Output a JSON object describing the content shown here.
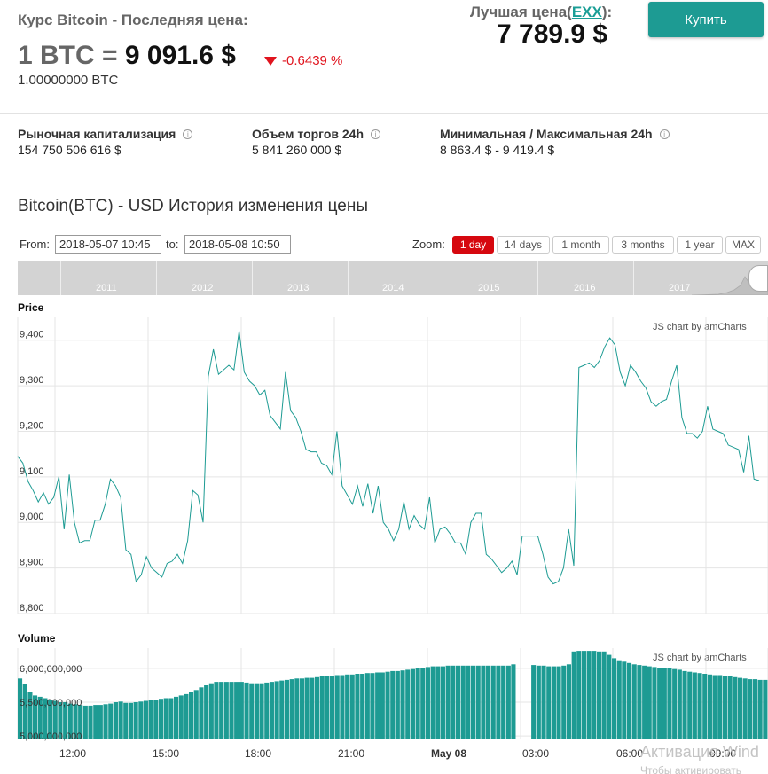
{
  "header": {
    "title": "Курс Bitcoin - Последняя цена:",
    "price_prefix": "1 BTC = ",
    "price_value": "9 091.6 $",
    "change": "-0.6439 %",
    "amount": "1.00000000 BTC",
    "best_price_label": "Лучшая цена(",
    "best_price_exchange": "EXX",
    "best_price_suffix": "):",
    "best_price_value": "7 789.9 $",
    "buy_label": "Купить"
  },
  "stats": [
    {
      "label": "Рыночная капитализация",
      "value": "154 750 506 616 $"
    },
    {
      "label": "Объем торгов 24h",
      "value": "5 841 260 000 $"
    },
    {
      "label": "Минимальная / Максимальная 24h",
      "value": "8 863.4 $ - 9 419.4 $"
    }
  ],
  "section_title": "Bitcoin(BTC) - USD История изменения цены",
  "range": {
    "from_label": "From:",
    "from_value": "2018-05-07 10:45",
    "to_label": "to:",
    "to_value": "2018-05-08 10:50",
    "zoom_label": "Zoom:",
    "zoom_buttons": [
      "1 day",
      "14 days",
      "1 month",
      "3 months",
      "1 year",
      "MAX"
    ],
    "active_zoom": "1 day"
  },
  "scrollbar": {
    "years": [
      "2011",
      "2012",
      "2013",
      "2014",
      "2015",
      "2016",
      "2017"
    ]
  },
  "charts": {
    "price_title": "Price",
    "volume_title": "Volume",
    "watermark": "JS chart by amCharts",
    "line_color": "#1d9b93",
    "bar_color": "#1d9b93"
  },
  "os_overlay": {
    "activate": "Активация Wind",
    "activate_sub": "Чтобы активировать"
  },
  "chart_data": [
    {
      "type": "line",
      "title": "Price",
      "x_axis": [
        "12:00",
        "15:00",
        "18:00",
        "21:00",
        "May 08",
        "03:00",
        "06:00",
        "09:00"
      ],
      "ylim": [
        8800,
        9450
      ],
      "yticks": [
        8800,
        8900,
        9000,
        9100,
        9200,
        9300,
        9400
      ],
      "ytick_labels": [
        "8,800",
        "8,900",
        "9,000",
        "9,100",
        "9,200",
        "9,300",
        "9,400"
      ],
      "grid": true,
      "series": [
        {
          "values": [
            9145,
            9130,
            9090,
            9070,
            9045,
            9065,
            9040,
            9055,
            9100,
            8985,
            9105,
            9000,
            8955,
            8960,
            8960,
            9005,
            9005,
            9040,
            9095,
            9080,
            9055,
            8940,
            8930,
            8870,
            8885,
            8925,
            8900,
            8890,
            8880,
            8910,
            8915,
            8930,
            8910,
            8960,
            9070,
            9060,
            9000,
            9320,
            9380,
            9325,
            9335,
            9345,
            9335,
            9420,
            9330,
            9310,
            9300,
            9280,
            9290,
            9235,
            9220,
            9205,
            9330,
            9245,
            9230,
            9200,
            9160,
            9155,
            9155,
            9130,
            9125,
            9105,
            9200,
            9080,
            9060,
            9040,
            9080,
            9035,
            9085,
            9020,
            9080,
            9000,
            8985,
            8960,
            8985,
            9045,
            8985,
            9015,
            8995,
            8985,
            9055,
            8955,
            8985,
            8990,
            8975,
            8955,
            8955,
            8930,
            9000,
            9020,
            9020,
            8930,
            8920,
            8905,
            8890,
            8900,
            8915,
            8885,
            8970,
            8970,
            8970,
            8970,
            8930,
            8880,
            8865,
            8870,
            8900,
            8985,
            8905,
            9340,
            9345,
            9350,
            9340,
            9355,
            9385,
            9405,
            9390,
            9330,
            9300,
            9345,
            9330,
            9310,
            9295,
            9265,
            9255,
            9265,
            9270,
            9310,
            9345,
            9230,
            9195,
            9195,
            9185,
            9200,
            9255,
            9205,
            9200,
            9195,
            9170,
            9165,
            9160,
            9110,
            9190,
            9095,
            9092
          ]
        }
      ]
    },
    {
      "type": "bar",
      "title": "Volume",
      "x_axis": [
        "12:00",
        "15:00",
        "18:00",
        "21:00",
        "May 08",
        "03:00",
        "06:00",
        "09:00"
      ],
      "ylim": [
        4950000000,
        6300000000
      ],
      "yticks": [
        5000000000,
        5500000000,
        6000000000
      ],
      "ytick_labels": [
        "5,000,000,000",
        "5,500,000,000",
        "6,000,000,000"
      ],
      "grid": true,
      "series": [
        {
          "values": [
            5850000000,
            5770000000,
            5650000000,
            5600000000,
            5580000000,
            5560000000,
            5540000000,
            5520000000,
            5500000000,
            5500000000,
            5480000000,
            5470000000,
            5460000000,
            5450000000,
            5450000000,
            5460000000,
            5460000000,
            5470000000,
            5480000000,
            5500000000,
            5510000000,
            5490000000,
            5490000000,
            5500000000,
            5510000000,
            5520000000,
            5530000000,
            5540000000,
            5550000000,
            5560000000,
            5560000000,
            5580000000,
            5600000000,
            5620000000,
            5650000000,
            5680000000,
            5720000000,
            5750000000,
            5780000000,
            5800000000,
            5800000000,
            5800000000,
            5800000000,
            5800000000,
            5800000000,
            5790000000,
            5780000000,
            5780000000,
            5780000000,
            5790000000,
            5800000000,
            5810000000,
            5820000000,
            5830000000,
            5840000000,
            5850000000,
            5850000000,
            5860000000,
            5860000000,
            5870000000,
            5880000000,
            5890000000,
            5890000000,
            5900000000,
            5900000000,
            5910000000,
            5910000000,
            5920000000,
            5920000000,
            5930000000,
            5930000000,
            5940000000,
            5940000000,
            5950000000,
            5960000000,
            5960000000,
            5970000000,
            5980000000,
            5990000000,
            6000000000,
            6010000000,
            6020000000,
            6030000000,
            6030000000,
            6030000000,
            6040000000,
            6040000000,
            6040000000,
            6040000000,
            6040000000,
            6040000000,
            6040000000,
            6040000000,
            6040000000,
            6040000000,
            6040000000,
            6040000000,
            6040000000,
            6060000000,
            0,
            0,
            0,
            6050000000,
            6040000000,
            6040000000,
            6030000000,
            6030000000,
            6030000000,
            6040000000,
            6060000000,
            6250000000,
            6260000000,
            6260000000,
            6260000000,
            6260000000,
            6250000000,
            6250000000,
            6200000000,
            6150000000,
            6120000000,
            6100000000,
            6080000000,
            6060000000,
            6050000000,
            6040000000,
            6030000000,
            6020000000,
            6010000000,
            6010000000,
            6000000000,
            5990000000,
            5980000000,
            5960000000,
            5950000000,
            5940000000,
            5930000000,
            5920000000,
            5910000000,
            5900000000,
            5900000000,
            5890000000,
            5880000000,
            5870000000,
            5860000000,
            5850000000,
            5840000000,
            5840000000,
            5830000000,
            5830000000
          ]
        }
      ]
    }
  ]
}
